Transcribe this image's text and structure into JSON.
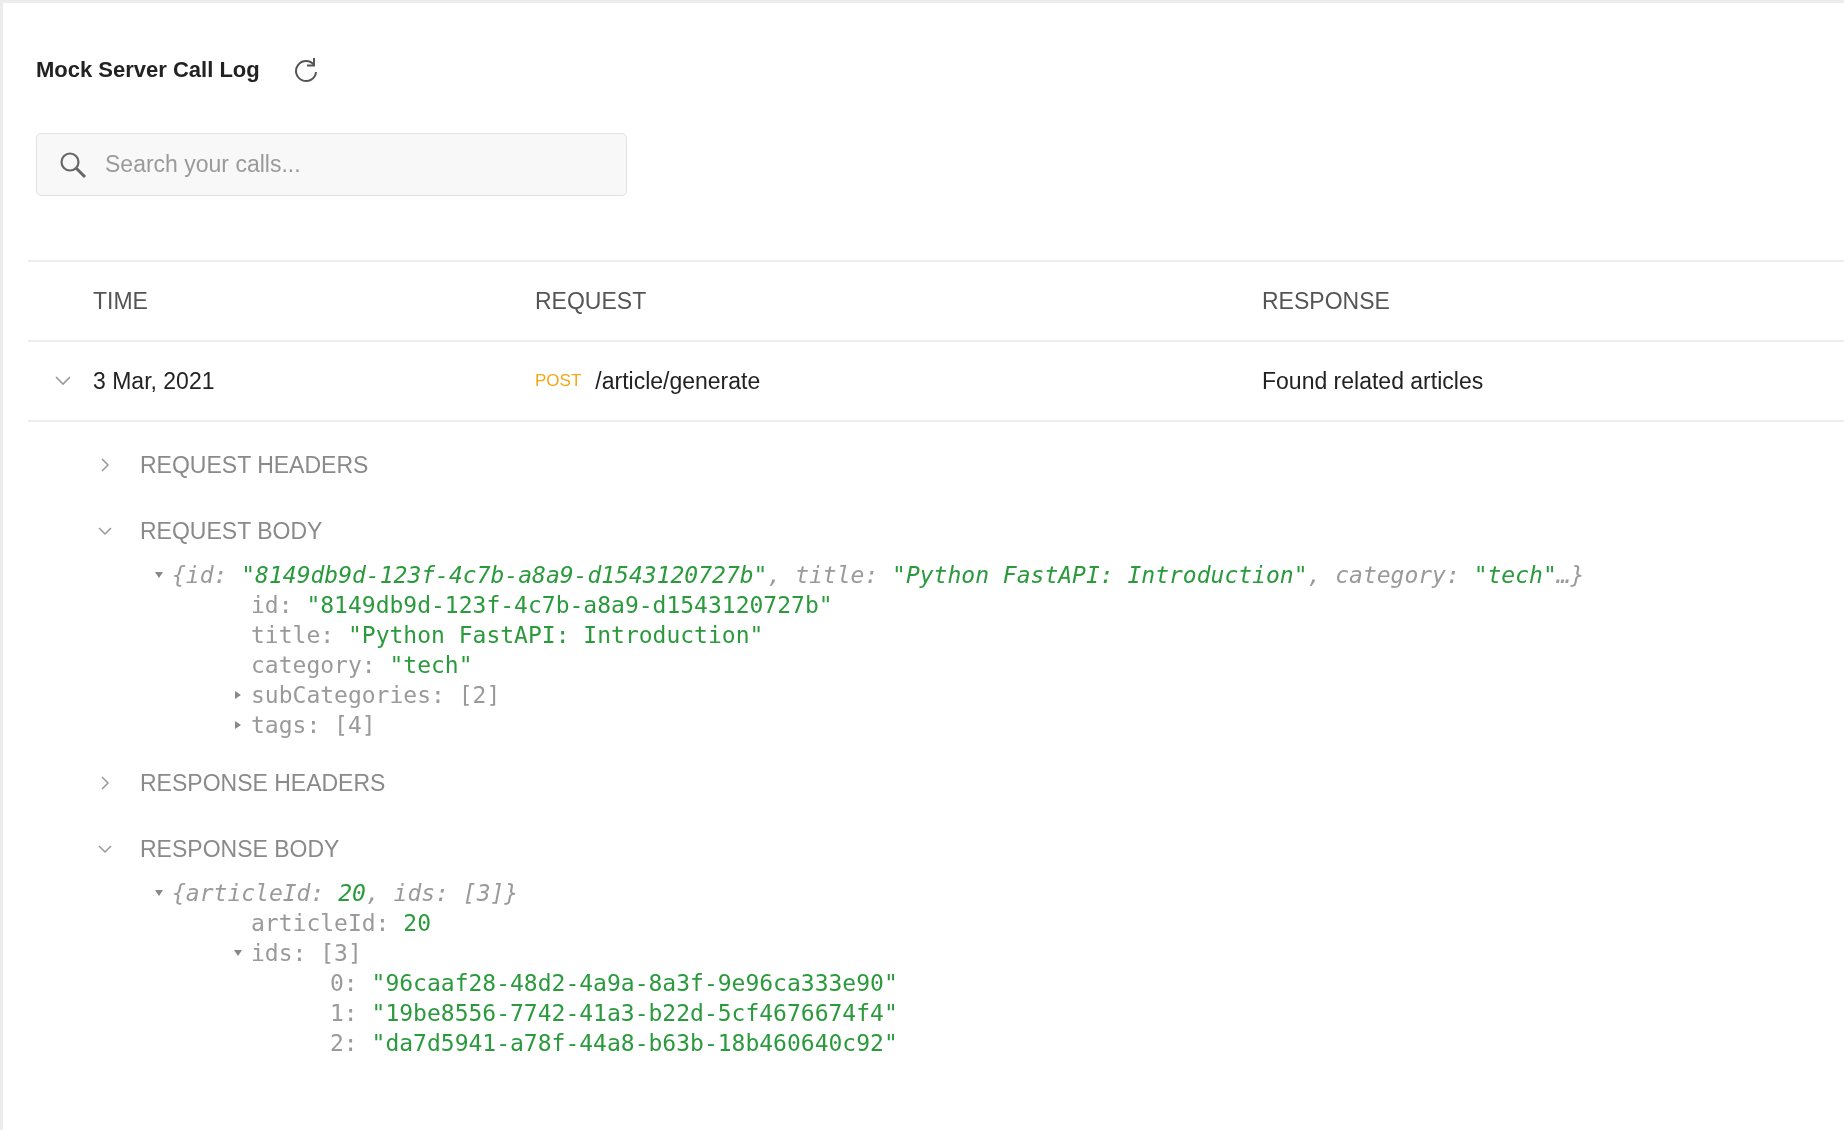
{
  "header": {
    "title": "Mock Server Call Log"
  },
  "search": {
    "placeholder": "Search your calls..."
  },
  "table": {
    "columns": [
      "TIME",
      "REQUEST",
      "RESPONSE"
    ],
    "rows": [
      {
        "expanded": true,
        "time": "3 Mar, 2021",
        "method": "POST",
        "path": "/article/generate",
        "response": "Found related articles",
        "sections": [
          {
            "title": "REQUEST HEADERS",
            "expanded": false
          },
          {
            "title": "REQUEST BODY",
            "expanded": true,
            "tree": {
              "expanded": true,
              "parts": [
                {
                  "text": "{id: ",
                  "kind": "key"
                },
                {
                  "text": "\"8149db9d-123f-4c7b-a8a9-d1543120727b\"",
                  "kind": "string"
                },
                {
                  "text": ", title: ",
                  "kind": "key"
                },
                {
                  "text": "\"Python FastAPI: Introduction\"",
                  "kind": "string"
                },
                {
                  "text": ", category: ",
                  "kind": "key"
                },
                {
                  "text": "\"tech\"",
                  "kind": "string"
                },
                {
                  "text": "…}",
                  "kind": "key"
                }
              ],
              "children": [
                {
                  "key": "id:",
                  "value": "\"8149db9d-123f-4c7b-a8a9-d1543120727b\"",
                  "kind": "string"
                },
                {
                  "key": "title:",
                  "value": "\"Python FastAPI: Introduction\"",
                  "kind": "string"
                },
                {
                  "key": "category:",
                  "value": "\"tech\"",
                  "kind": "string"
                },
                {
                  "key": "subCategories:",
                  "value": "[2]",
                  "kind": "array",
                  "expanded": false
                },
                {
                  "key": "tags:",
                  "value": "[4]",
                  "kind": "array",
                  "expanded": false
                }
              ]
            }
          },
          {
            "title": "RESPONSE HEADERS",
            "expanded": false
          },
          {
            "title": "RESPONSE BODY",
            "expanded": true,
            "tree": {
              "expanded": true,
              "parts": [
                {
                  "text": "{articleId: ",
                  "kind": "key"
                },
                {
                  "text": "20",
                  "kind": "number"
                },
                {
                  "text": ", ids: [3]}",
                  "kind": "key"
                }
              ],
              "children": [
                {
                  "key": "articleId:",
                  "value": "20",
                  "kind": "number"
                },
                {
                  "key": "ids:",
                  "value": "[3]",
                  "kind": "array",
                  "expanded": true,
                  "children": [
                    {
                      "key": "0:",
                      "value": "\"96caaf28-48d2-4a9a-8a3f-9e96ca333e90\"",
                      "kind": "string"
                    },
                    {
                      "key": "1:",
                      "value": "\"19be8556-7742-41a3-b22d-5cf4676674f4\"",
                      "kind": "string"
                    },
                    {
                      "key": "2:",
                      "value": "\"da7d5941-a78f-44a8-b63b-18b460640c92\"",
                      "kind": "string"
                    }
                  ]
                }
              ]
            }
          }
        ]
      }
    ]
  }
}
